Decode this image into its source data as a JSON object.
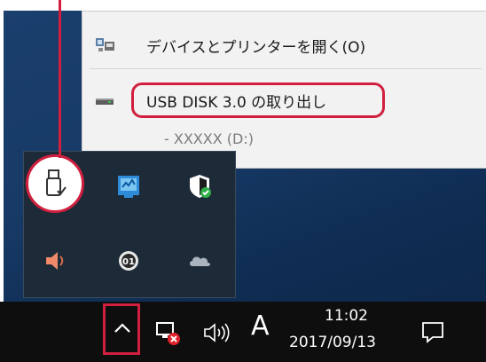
{
  "context_menu": {
    "open_devices_label": "デバイスとプリンターを開く(O)",
    "eject_label": "USB DISK 3.0 の取り出し",
    "drive_label": "-  XXXXX (D:)"
  },
  "tray_icons": [
    "usb-drive-icon",
    "network-monitor-icon",
    "security-shield-icon",
    "speaker-icon",
    "u1-badge-icon",
    "onedrive-cloud-icon"
  ],
  "taskbar": {
    "ime_indicator": "A",
    "clock_time": "11:02",
    "clock_date": "2017/09/13"
  },
  "colors": {
    "highlight": "#d1203f",
    "taskbar": "#0e0e0e",
    "menu_bg": "#f2f2f2",
    "tray_bg": "#1d2a38"
  }
}
